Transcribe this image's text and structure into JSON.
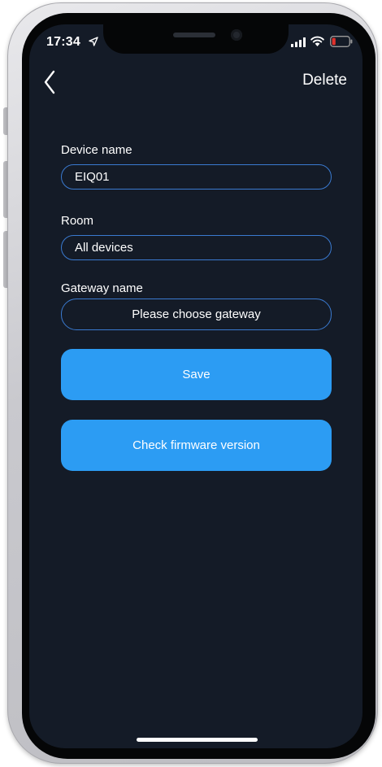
{
  "status_bar": {
    "time": "17:34",
    "location_icon": "location-arrow-icon",
    "signal_icon": "cellular-signal-icon",
    "wifi_icon": "wifi-icon",
    "battery_icon": "battery-low-icon",
    "battery_color": "#e0312c"
  },
  "nav": {
    "back_icon": "chevron-left-icon",
    "delete_label": "Delete"
  },
  "form": {
    "device_name": {
      "label": "Device name",
      "value": "EIQ01"
    },
    "room": {
      "label": "Room",
      "value": "All devices"
    },
    "gateway": {
      "label": "Gateway name",
      "placeholder": "Please choose gateway"
    }
  },
  "buttons": {
    "save_label": "Save",
    "check_firmware_label": "Check firmware version"
  },
  "colors": {
    "background": "#141b27",
    "accent": "#2c9cf3",
    "input_border": "#3a7ad0",
    "text": "#ffffff"
  }
}
